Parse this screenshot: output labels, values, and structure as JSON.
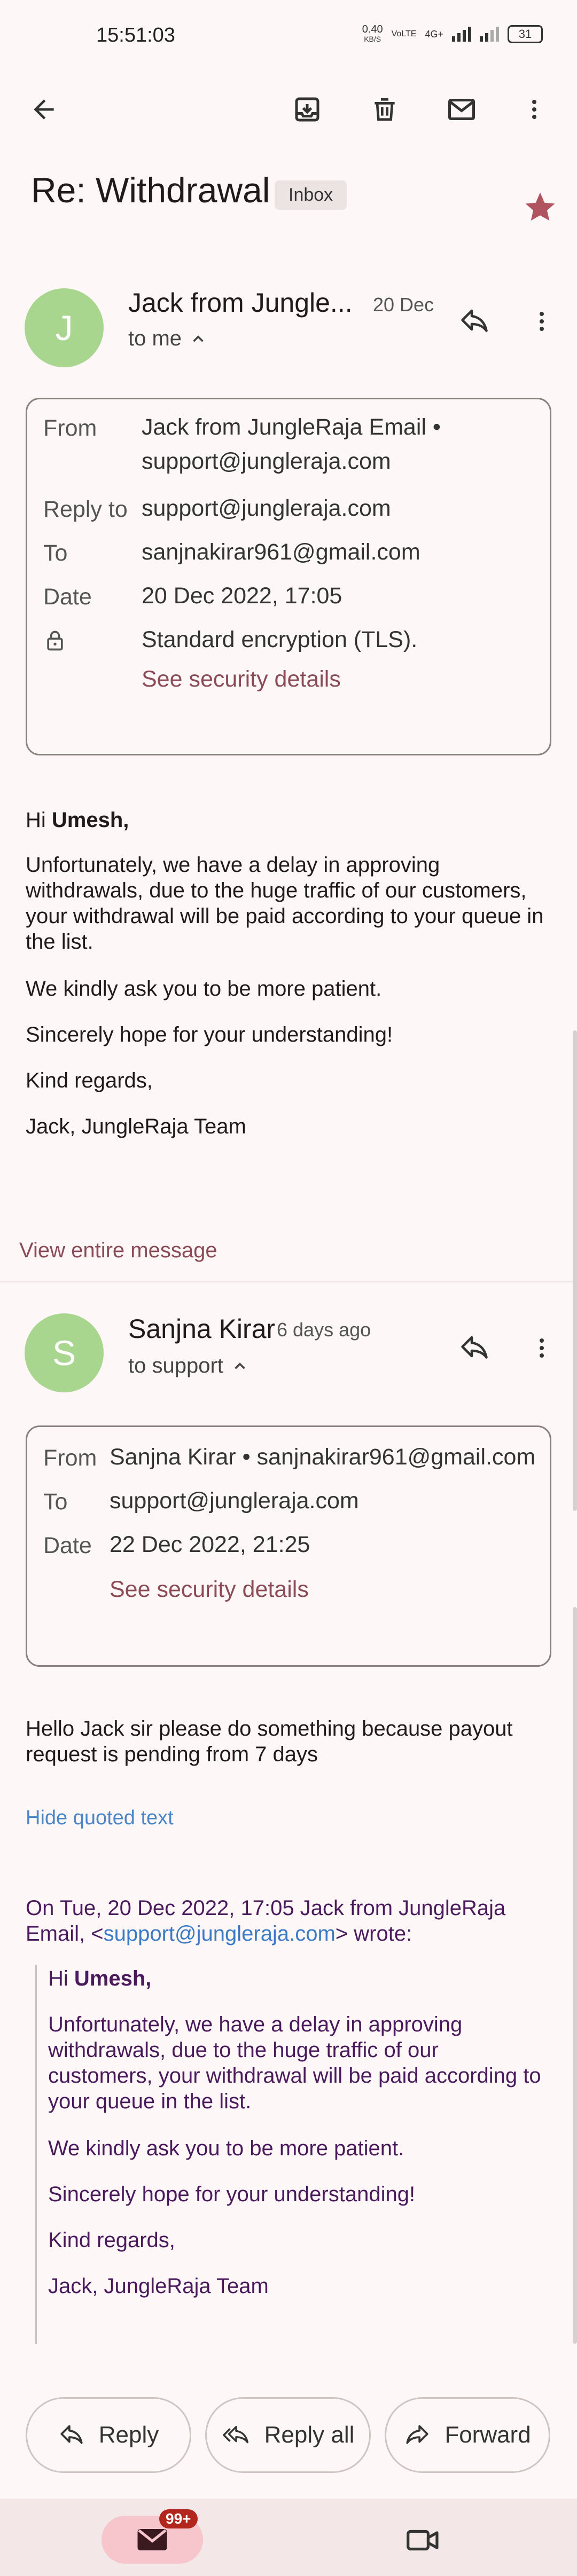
{
  "status_bar": {
    "time": "15:51:03",
    "net_speed": "0.40",
    "net_unit": "KB/S",
    "volte": "VoLTE",
    "network": "4G+",
    "battery": "31"
  },
  "toolbar": {
    "back_icon": "arrow-back-icon",
    "archive_icon": "archive-icon",
    "delete_icon": "trash-icon",
    "mail_icon": "mail-icon",
    "more_icon": "more-vertical-icon"
  },
  "email": {
    "subject": "Re: Withdrawal",
    "label": "Inbox",
    "starred": true
  },
  "message1": {
    "avatar_letter": "J",
    "sender": "Jack from Jungle...",
    "date": "20 Dec",
    "to_line": "to me",
    "details": {
      "from_label": "From",
      "from_value_1": "Jack from JungleRaja Email •",
      "from_value_2": "support@jungleraja.com",
      "reply_to_label": "Reply to",
      "reply_to_value": "support@jungleraja.com",
      "to_label": "To",
      "to_value": "sanjnakirar961@gmail.com",
      "date_label": "Date",
      "date_value": "20 Dec 2022, 17:05",
      "encryption": "Standard encryption (TLS).",
      "security_link": "See security details"
    },
    "body": {
      "greeting_prefix": "Hi ",
      "greeting_name": "Umesh,",
      "p1": "Unfortunately, we have a delay in approving withdrawals, due to the huge traffic of our customers, your withdrawal will be paid according to your queue in the list.",
      "p2": "We kindly ask you to be more patient.",
      "p3": "Sincerely hope for your understanding!",
      "p4": "Kind regards,",
      "p5": "Jack, JungleRaja Team"
    },
    "view_entire": "View entire message"
  },
  "message2": {
    "avatar_letter": "S",
    "sender": "Sanjna Kirar",
    "date": "6 days ago",
    "to_line": "to support",
    "details": {
      "from_label": "From",
      "from_value": "Sanjna Kirar • sanjnakirar961@gmail.com",
      "to_label": "To",
      "to_value": "support@jungleraja.com",
      "date_label": "Date",
      "date_value": "22 Dec 2022, 21:25",
      "security_link": "See security details"
    },
    "body": "Hello Jack sir please do something because payout request is pending from 7 days",
    "hide_quoted": "Hide quoted text",
    "quoted_header_1": "On Tue, 20 Dec 2022, 17:05 Jack from JungleRaja Email, <",
    "quoted_header_email": "support@jungleraja.com",
    "quoted_header_2": "> wrote:",
    "quoted": {
      "greeting_prefix": "Hi ",
      "greeting_name": "Umesh,",
      "p1": "Unfortunately, we have a delay in approving withdrawals, due to the huge traffic of our customers, your withdrawal will be paid according to your queue in the list.",
      "p2": "We kindly ask you to be more patient.",
      "p3": "Sincerely hope for your understanding!",
      "p4": "Kind regards,",
      "p5": "Jack, JungleRaja Team"
    }
  },
  "actions": {
    "reply": "Reply",
    "reply_all": "Reply all",
    "forward": "Forward"
  },
  "bottom_nav": {
    "mail_badge": "99+",
    "mail_icon": "mail-icon",
    "meet_icon": "video-icon"
  },
  "colors": {
    "accent": "#8b4b56",
    "avatar": "#a9d68e",
    "link": "#4a86c8",
    "quoted_text": "#4a1a5c",
    "star": "#b0555f"
  }
}
